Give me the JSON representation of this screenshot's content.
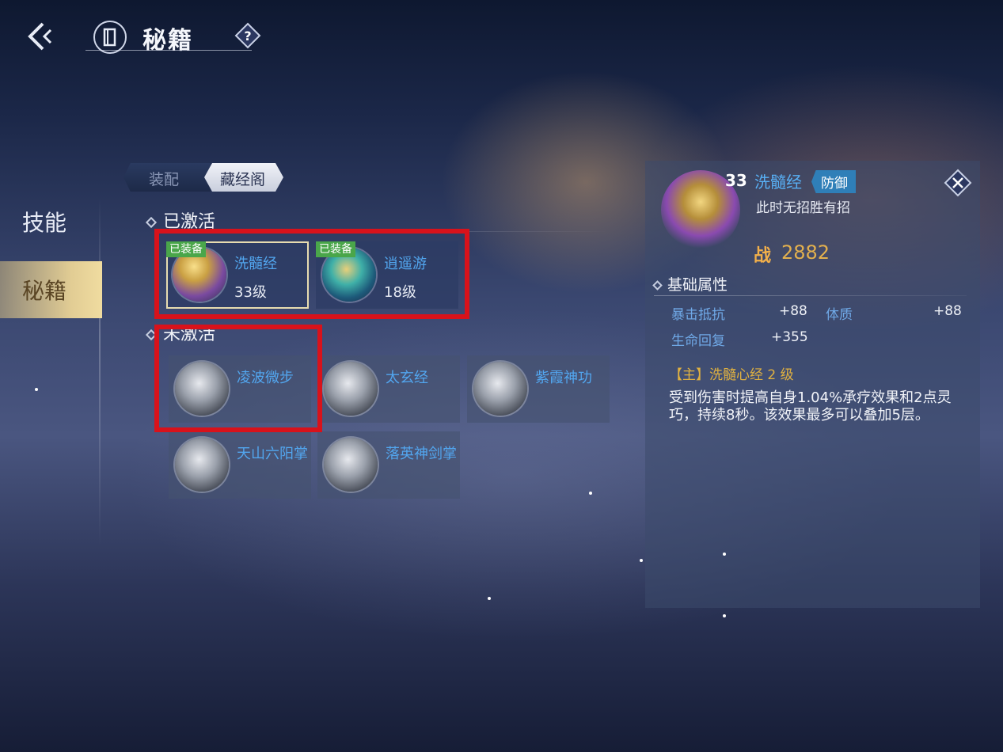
{
  "header": {
    "title": "秘籍"
  },
  "sidenav": {
    "items": [
      {
        "label": "技能"
      },
      {
        "label": "秘籍"
      }
    ]
  },
  "tabs": [
    {
      "label": "装配"
    },
    {
      "label": "藏经阁"
    }
  ],
  "sections": {
    "activated": {
      "heading": "已激活",
      "items": [
        {
          "name": "洗髓经",
          "level": "33级",
          "badge": "已装备"
        },
        {
          "name": "逍遥游",
          "level": "18级",
          "badge": "已装备"
        }
      ]
    },
    "inactive": {
      "heading": "未激活",
      "items": [
        {
          "name": "凌波微步"
        },
        {
          "name": "太玄经"
        },
        {
          "name": "紫霞神功"
        },
        {
          "name": "天山六阳掌"
        },
        {
          "name": "落英神剑掌"
        }
      ]
    }
  },
  "detail": {
    "level": "33",
    "name": "洗髓经",
    "tag": "防御",
    "subtitle": "此时无招胜有招",
    "power_icon": "战",
    "power": "2882",
    "attr_heading": "基础属性",
    "attributes": [
      {
        "label": "暴击抵抗",
        "value": "+88"
      },
      {
        "label": "体质",
        "value": "+88"
      },
      {
        "label": "生命回复",
        "value": "+355"
      }
    ],
    "effect_title": "【主】洗髓心经 2 级",
    "effect_desc": "受到伤害时提高自身1.04%承疗效果和2点灵巧，持续8秒。该效果最多可以叠加5层。"
  },
  "colors": {
    "accent_blue": "#52a6ef",
    "gold": "#e0b140",
    "highlight_red": "#d8121b",
    "equipped_green": "#4aa64a"
  },
  "icons": [
    "back-arrow-icon",
    "book-icon",
    "help-icon",
    "close-icon",
    "diamond-marker-icon"
  ]
}
